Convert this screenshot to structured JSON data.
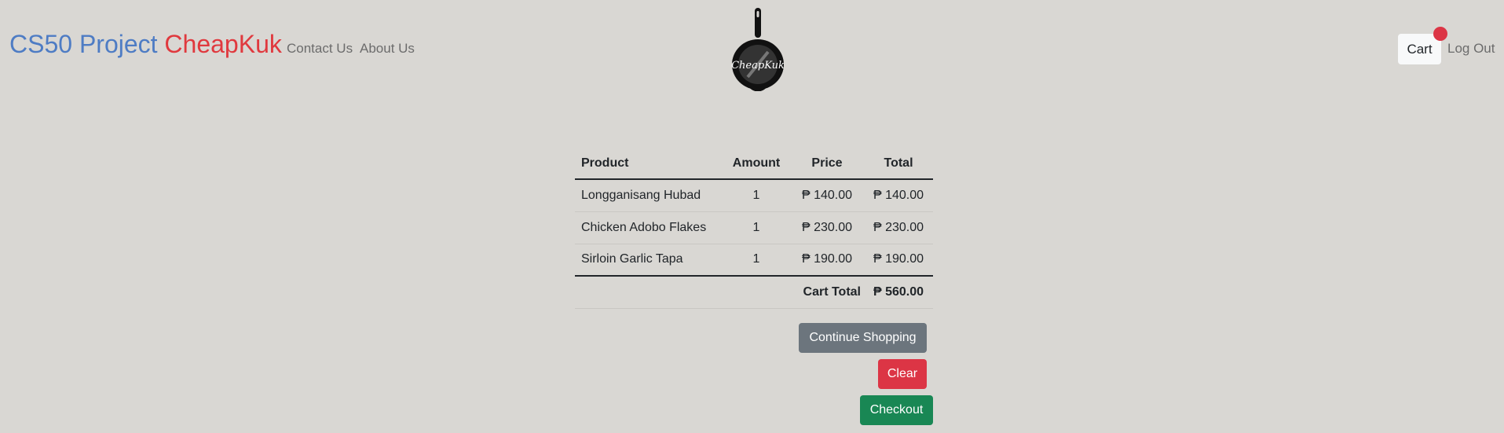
{
  "navbar": {
    "brand_part1": "CS50 Project",
    "brand_part2": "CheapKuk",
    "links": [
      "Contact Us",
      "About Us"
    ],
    "cart_label": "Cart",
    "logout_label": "Log Out",
    "logo_text": "CheapKuk"
  },
  "cart_table": {
    "headers": {
      "product": "Product",
      "amount": "Amount",
      "price": "Price",
      "total": "Total"
    },
    "rows": [
      {
        "product": "Longganisang Hubad",
        "amount": "1",
        "price": "₱ 140.00",
        "total": "₱ 140.00"
      },
      {
        "product": "Chicken Adobo Flakes",
        "amount": "1",
        "price": "₱ 230.00",
        "total": "₱ 230.00"
      },
      {
        "product": "Sirloin Garlic Tapa",
        "amount": "1",
        "price": "₱ 190.00",
        "total": "₱ 190.00"
      }
    ],
    "cart_total_label": "Cart Total",
    "cart_total_value": "₱ 560.00"
  },
  "actions": {
    "continue_label": "Continue Shopping",
    "clear_label": "Clear",
    "checkout_label": "Checkout"
  },
  "colors": {
    "background": "#d9d7d3",
    "brand_blue": "#4e7cc4",
    "brand_red": "#e0393e",
    "secondary": "#6c757d",
    "danger": "#dc3545",
    "success": "#198754"
  }
}
